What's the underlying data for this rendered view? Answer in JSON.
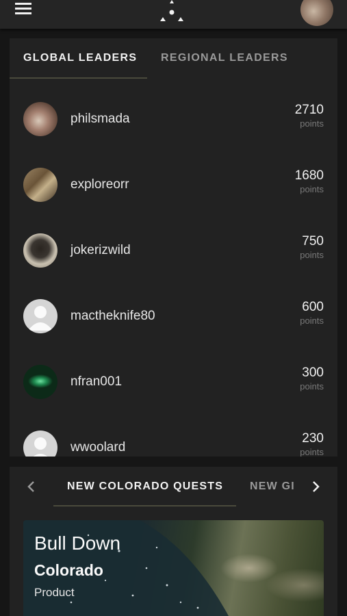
{
  "header": {
    "menu_icon": "hamburger-menu-icon",
    "logo_icon": "triangle-dots-logo-icon",
    "avatar": "user-avatar"
  },
  "leaderboard": {
    "tabs": [
      {
        "label": "GLOBAL LEADERS",
        "active": true
      },
      {
        "label": "REGIONAL LEADERS",
        "active": false
      }
    ],
    "entries": [
      {
        "name": "philsmada",
        "score": "2710",
        "unit": "points"
      },
      {
        "name": "exploreorr",
        "score": "1680",
        "unit": "points"
      },
      {
        "name": "jokerizwild",
        "score": "750",
        "unit": "points"
      },
      {
        "name": "mactheknife80",
        "score": "600",
        "unit": "points"
      },
      {
        "name": "nfran001",
        "score": "300",
        "unit": "points"
      },
      {
        "name": "wwoolard",
        "score": "230",
        "unit": "points"
      }
    ]
  },
  "quests": {
    "prev_icon": "chevron-left-icon",
    "next_icon": "chevron-right-icon",
    "tabs": [
      {
        "label": "NEW COLORADO QUESTS",
        "active": true
      },
      {
        "label": "NEW GI",
        "active": false
      }
    ],
    "card": {
      "title": "Bull Down",
      "subtitle": "Colorado",
      "type": "Product"
    }
  },
  "colors": {
    "background": "#161616",
    "card": "#222222",
    "topbar": "#252525",
    "tab_active": "#f2f2f2",
    "tab_inactive": "#9a9a9a",
    "tab_underline": "#4a4a3c",
    "points_label": "#7a7a7a"
  }
}
